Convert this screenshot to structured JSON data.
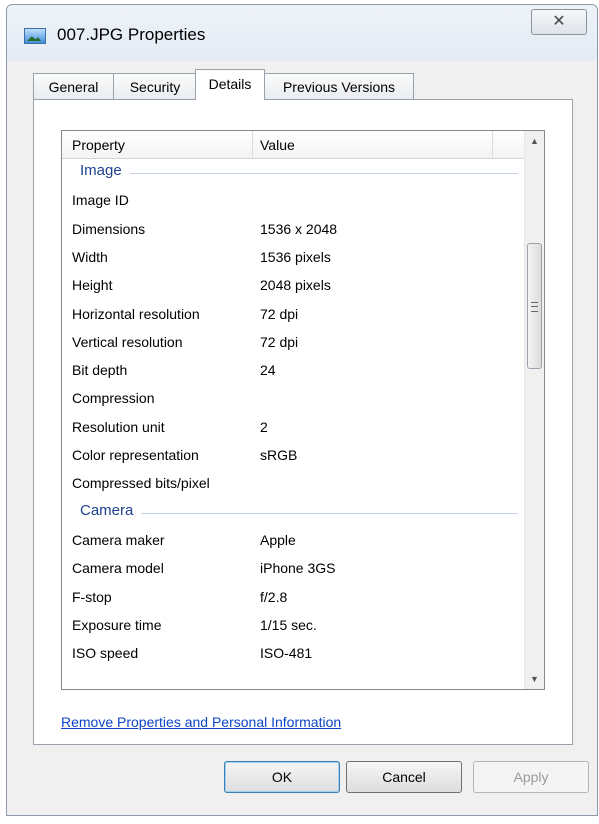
{
  "window": {
    "title": "007.JPG Properties",
    "close_glyph": "✕"
  },
  "tabs": [
    {
      "label": "General",
      "active": false
    },
    {
      "label": "Security",
      "active": false
    },
    {
      "label": "Details",
      "active": true
    },
    {
      "label": "Previous Versions",
      "active": false
    }
  ],
  "details": {
    "columns": {
      "property": "Property",
      "value": "Value"
    },
    "groups": [
      {
        "label": "Image",
        "rows": [
          {
            "property": "Image ID",
            "value": ""
          },
          {
            "property": "Dimensions",
            "value": "1536 x 2048"
          },
          {
            "property": "Width",
            "value": "1536 pixels"
          },
          {
            "property": "Height",
            "value": "2048 pixels"
          },
          {
            "property": "Horizontal resolution",
            "value": "72 dpi"
          },
          {
            "property": "Vertical resolution",
            "value": "72 dpi"
          },
          {
            "property": "Bit depth",
            "value": "24"
          },
          {
            "property": "Compression",
            "value": ""
          },
          {
            "property": "Resolution unit",
            "value": "2"
          },
          {
            "property": "Color representation",
            "value": "sRGB"
          },
          {
            "property": "Compressed bits/pixel",
            "value": ""
          }
        ]
      },
      {
        "label": "Camera",
        "rows": [
          {
            "property": "Camera maker",
            "value": "Apple"
          },
          {
            "property": "Camera model",
            "value": "iPhone 3GS"
          },
          {
            "property": "F-stop",
            "value": "f/2.8"
          },
          {
            "property": "Exposure time",
            "value": "1/15 sec."
          },
          {
            "property": "ISO speed",
            "value": "ISO-481"
          }
        ]
      }
    ]
  },
  "link_label": "Remove Properties and Personal Information",
  "buttons": {
    "ok": "OK",
    "cancel": "Cancel",
    "apply": "Apply"
  },
  "icons": {
    "scroll_up": "▲",
    "scroll_down": "▼"
  },
  "colors": {
    "group_label": "#1e3f91",
    "link": "#0d46c9"
  }
}
